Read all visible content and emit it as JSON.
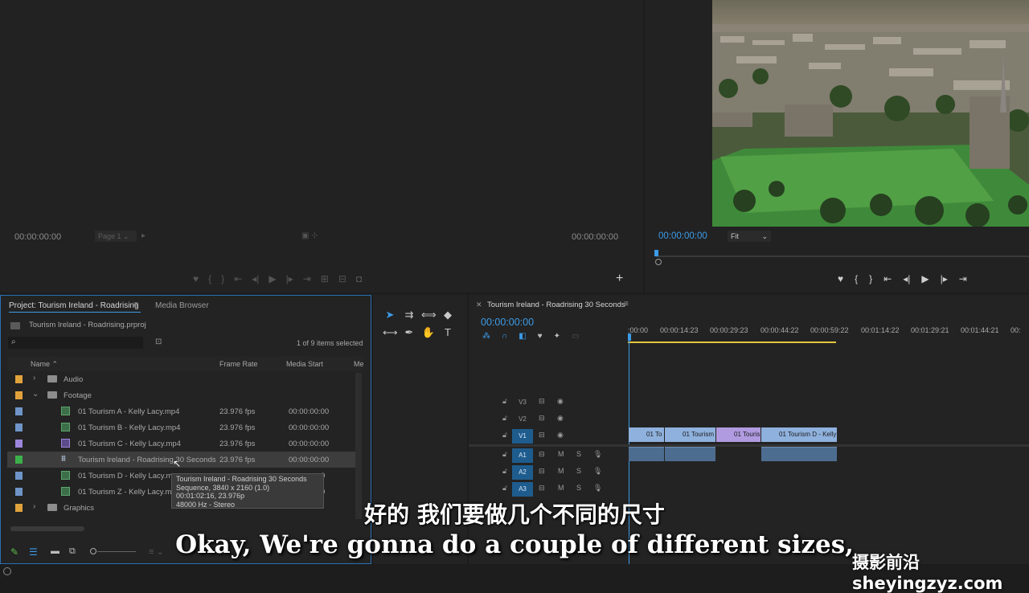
{
  "source_monitor": {
    "timecode_left": "00:00:00:00",
    "page_label": "Page 1",
    "timecode_right": "00:00:00:00"
  },
  "program_monitor": {
    "timecode": "00:00:00:00",
    "fit_label": "Fit"
  },
  "project": {
    "tab_project": "Project: Tourism Ireland - Roadrising",
    "tab_media_browser": "Media Browser",
    "file_name": "Tourism Ireland - Roadrising.prproj",
    "search_placeholder": "",
    "selection_info": "1 of 9 items selected",
    "col_name": "Name",
    "col_frame_rate": "Frame Rate",
    "col_media_start": "Media Start",
    "col_more": "Me",
    "rows": [
      {
        "label_color": "#e0a33c",
        "kind": "folder",
        "name": "Audio",
        "frame_rate": "",
        "media_start": "",
        "expanded": false
      },
      {
        "label_color": "#e0a33c",
        "kind": "folder",
        "name": "Footage",
        "frame_rate": "",
        "media_start": "",
        "expanded": true
      },
      {
        "label_color": "#6f95c8",
        "kind": "clip",
        "name": "01 Tourism A - Kelly Lacy.mp4",
        "frame_rate": "23.976 fps",
        "media_start": "00:00:00:00"
      },
      {
        "label_color": "#6f95c8",
        "kind": "clip",
        "name": "01 Tourism B - Kelly Lacy.mp4",
        "frame_rate": "23.976 fps",
        "media_start": "00:00:00:00"
      },
      {
        "label_color": "#9d86d9",
        "kind": "clip",
        "name": "01 Tourism C - Kelly Lacy.mp4",
        "frame_rate": "23.976 fps",
        "media_start": "00:00:00:00"
      },
      {
        "label_color": "#3cb04a",
        "kind": "sequence",
        "name": "Tourism Ireland - Roadrising 30 Seconds",
        "frame_rate": "23.976 fps",
        "media_start": "00:00:00:00"
      },
      {
        "label_color": "#6f95c8",
        "kind": "clip",
        "name": "01 Tourism D - Kelly Lacy.mp",
        "frame_rate": "",
        "media_start": "0"
      },
      {
        "label_color": "#6f95c8",
        "kind": "clip",
        "name": "01 Tourism Z - Kelly Lacy.mp",
        "frame_rate": "",
        "media_start": "0"
      },
      {
        "label_color": "#e0a33c",
        "kind": "folder",
        "name": "Graphics",
        "frame_rate": "",
        "media_start": "",
        "expanded": false
      }
    ],
    "tooltip": {
      "line1": "Tourism Ireland - Roadrising 30 Seconds",
      "line2": "Sequence, 3840 x 2160 (1.0)",
      "line3": "00:01:02:16, 23.976p",
      "line4": "48000 Hz - Stereo"
    }
  },
  "timeline": {
    "tab_title": "Tourism Ireland - Roadrising 30 Seconds",
    "timecode": "00:00:00:00",
    "ruler": [
      ":00:00",
      "00:00:14:23",
      "00:00:29:23",
      "00:00:44:22",
      "00:00:59:22",
      "00:01:14:22",
      "00:01:29:21",
      "00:01:44:21",
      "00:"
    ],
    "video_tracks": [
      "V3",
      "V2",
      "V1"
    ],
    "audio_tracks": [
      "A1",
      "A2",
      "A3"
    ],
    "mute_label": "M",
    "solo_label": "S",
    "clips_v1": [
      {
        "label": "01 To",
        "color": "blue"
      },
      {
        "label": "01 Tourism",
        "color": "blue"
      },
      {
        "label": "01 Touris",
        "color": "purple"
      },
      {
        "label": "01 Tourism D - Kelly",
        "color": "blue"
      }
    ]
  },
  "subtitles": {
    "chinese": "好的 我们要做几个不同的尺寸",
    "english": "Okay, We're gonna do a couple of different sizes,"
  },
  "watermark": "摄影前沿 sheyingzyz.com"
}
